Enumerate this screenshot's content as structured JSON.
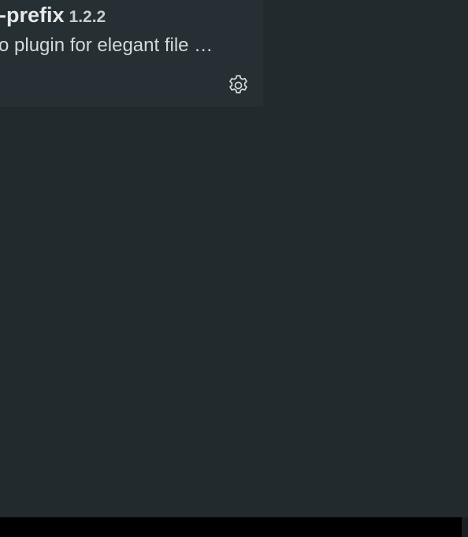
{
  "extension": {
    "name": "-prefix",
    "version": "1.2.2",
    "description": "o plugin for elegant file …",
    "icon": "gear-icon"
  },
  "colors": {
    "background": "#232a2d",
    "card": "#262f34",
    "statusbar": "#000000"
  }
}
